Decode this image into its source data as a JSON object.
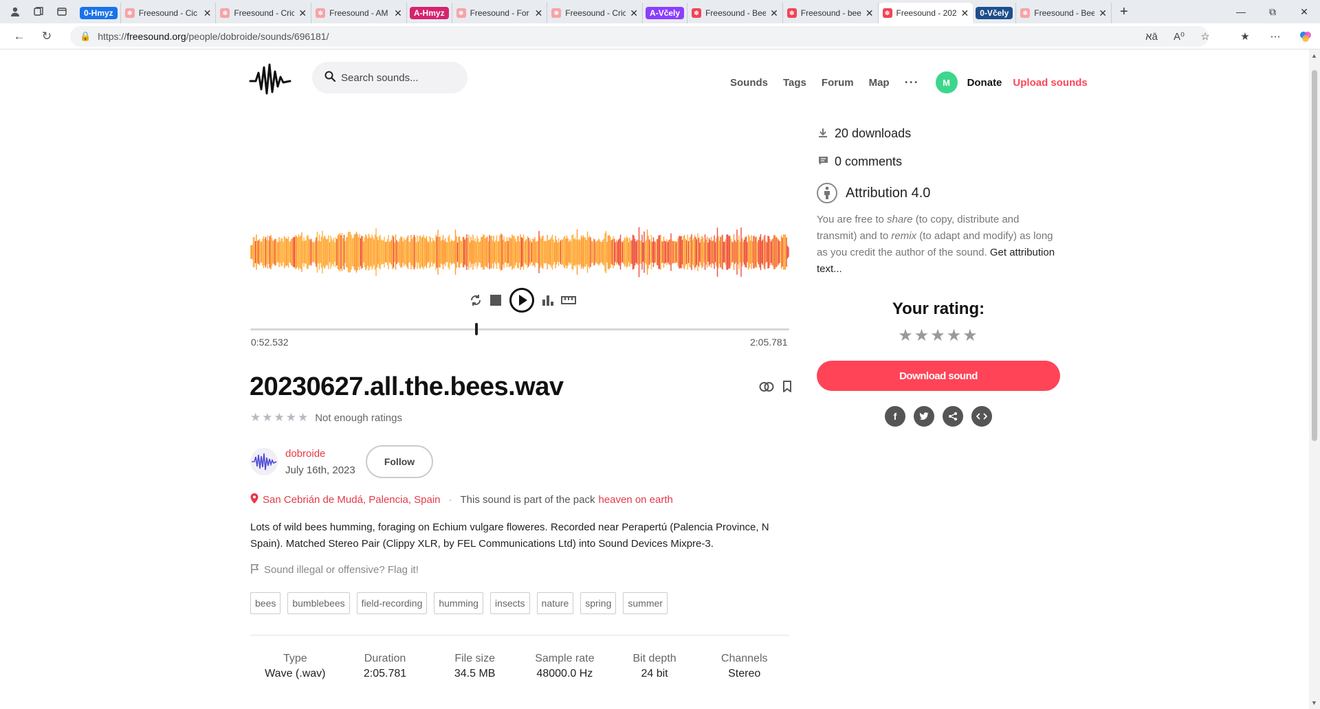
{
  "browser": {
    "tabs": [
      {
        "type": "group",
        "label": "0-Hmyz",
        "color": "#1a73e8"
      },
      {
        "type": "tab",
        "label": "Freesound - Cic",
        "fav": "light"
      },
      {
        "type": "tab",
        "label": "Freesound - Cric",
        "fav": "light"
      },
      {
        "type": "tab",
        "label": "Freesound - AM",
        "fav": "light"
      },
      {
        "type": "group",
        "label": "A-Hmyz",
        "color": "#d6246e"
      },
      {
        "type": "tab",
        "label": "Freesound - For",
        "fav": "light"
      },
      {
        "type": "tab",
        "label": "Freesound - Cric",
        "fav": "light"
      },
      {
        "type": "group",
        "label": "A-Včely",
        "color": "#8a3ffc"
      },
      {
        "type": "tab",
        "label": "Freesound - Bee",
        "fav": "red"
      },
      {
        "type": "tab",
        "label": "Freesound - bee",
        "fav": "red"
      },
      {
        "type": "tab",
        "label": "Freesound - 202",
        "fav": "red",
        "active": true
      },
      {
        "type": "group",
        "label": "0-Včely",
        "color": "#1e4e8c"
      },
      {
        "type": "tab",
        "label": "Freesound - Bee",
        "fav": "light"
      }
    ],
    "url_prefix": "https://",
    "url_domain": "freesound.org",
    "url_path": "/people/dobroide/sounds/696181/"
  },
  "header": {
    "search_placeholder": "Search sounds...",
    "nav": [
      "Sounds",
      "Tags",
      "Forum",
      "Map"
    ],
    "more": "···",
    "avatar_letter": "M",
    "donate": "Donate",
    "upload": "Upload sounds"
  },
  "player": {
    "current_time": "0:52.532",
    "total_time": "2:05.781",
    "progress_fraction": 0.42
  },
  "sound": {
    "title": "20230627.all.the.bees.wav",
    "rating_stars": "★★★★★",
    "rating_text": "Not enough ratings",
    "username": "dobroide",
    "date": "July 16th, 2023",
    "follow": "Follow",
    "location": "San Cebrián de Mudá, Palencia, Spain",
    "pack_text": "This sound is part of the pack",
    "pack_name": "heaven on earth",
    "description": "Lots of wild bees humming, foraging on Echium vulgare floweres. Recorded near Perapertú (Palencia Province, N Spain). Matched Stereo Pair (Clippy XLR, by FEL Communications Ltd) into Sound Devices Mixpre-3.",
    "flag_text": "Sound illegal or offensive? Flag it!",
    "tags": [
      "bees",
      "bumblebees",
      "field-recording",
      "humming",
      "insects",
      "nature",
      "spring",
      "summer"
    ],
    "meta": [
      {
        "h": "Type",
        "v": "Wave (.wav)"
      },
      {
        "h": "Duration",
        "v": "2:05.781"
      },
      {
        "h": "File size",
        "v": "34.5 MB"
      },
      {
        "h": "Sample rate",
        "v": "48000.0 Hz"
      },
      {
        "h": "Bit depth",
        "v": "24 bit"
      },
      {
        "h": "Channels",
        "v": "Stereo"
      }
    ]
  },
  "sidebar": {
    "downloads": "20 downloads",
    "comments": "0 comments",
    "license": "Attribution 4.0",
    "license_text_1": "You are free to ",
    "license_share": "share",
    "license_text_2": " (to copy, distribute and transmit) and to ",
    "license_remix": "remix",
    "license_text_3": " (to adapt and modify) as long as you credit the author of the sound. ",
    "license_link": "Get attribution text...",
    "your_rating": "Your rating:",
    "rate_stars": "★★★★★",
    "download": "Download sound"
  },
  "colors": {
    "accent": "#ff4457",
    "wave_orange": "#ff9a2e",
    "wave_red": "#ee4d3a"
  }
}
